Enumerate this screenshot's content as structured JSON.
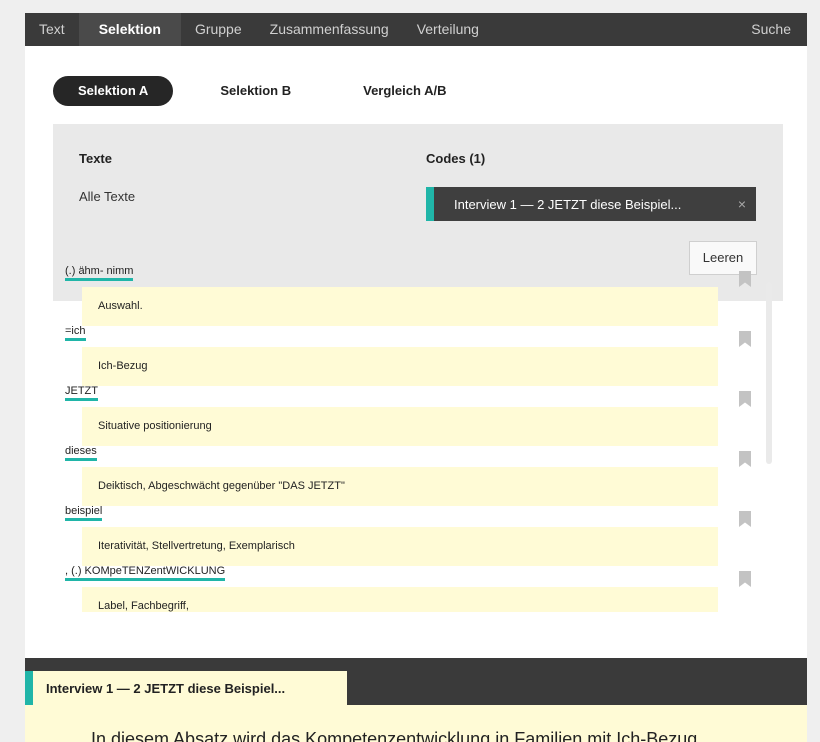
{
  "nav": {
    "tabs": [
      {
        "label": "Text",
        "active": false
      },
      {
        "label": "Selektion",
        "active": true
      },
      {
        "label": "Gruppe",
        "active": false
      },
      {
        "label": "Zusammenfassung",
        "active": false
      },
      {
        "label": "Verteilung",
        "active": false
      }
    ],
    "search_label": "Suche"
  },
  "subtabs": [
    {
      "label": "Selektion A",
      "active": true
    },
    {
      "label": "Selektion B",
      "active": false
    },
    {
      "label": "Vergleich A/B",
      "active": false
    }
  ],
  "filter": {
    "texts_label": "Texte",
    "texts_value": "Alle Texte",
    "codes_label": "Codes (1)",
    "code_chip": "Interview 1 — 2 JETZT diese Beispiel...",
    "close_icon": "×",
    "clear_label": "Leeren"
  },
  "results": [
    {
      "segment": "(.) ähm- nimm",
      "memo": "Auswahl."
    },
    {
      "segment": "=ich",
      "memo": "Ich-Bezug"
    },
    {
      "segment": "JETZT",
      "memo": "Situative positionierung"
    },
    {
      "segment": "dieses",
      "memo": "Deiktisch, Abgeschwächt gegenüber \"DAS JETZT\""
    },
    {
      "segment": "beispiel",
      "memo": "Iterativität, Stellvertretung, Exemplarisch"
    },
    {
      "segment": ", (.) KOMpeTENZentWICKLUNG",
      "memo": "Label, Fachbegriff,"
    }
  ],
  "bottom": {
    "tab_label": "Interview 1 — 2 JETZT diese Beispiel...",
    "paragraph": "In diesem Absatz wird das Kompetenzentwicklung in Familien mit Ich-Bezug"
  },
  "colors": {
    "accent": "#20b5a8",
    "dark_bar": "#3a3a3a",
    "memo_bg": "#fffbd6"
  },
  "icons": {
    "bookmark": "bookmark-icon",
    "close": "close-icon"
  }
}
